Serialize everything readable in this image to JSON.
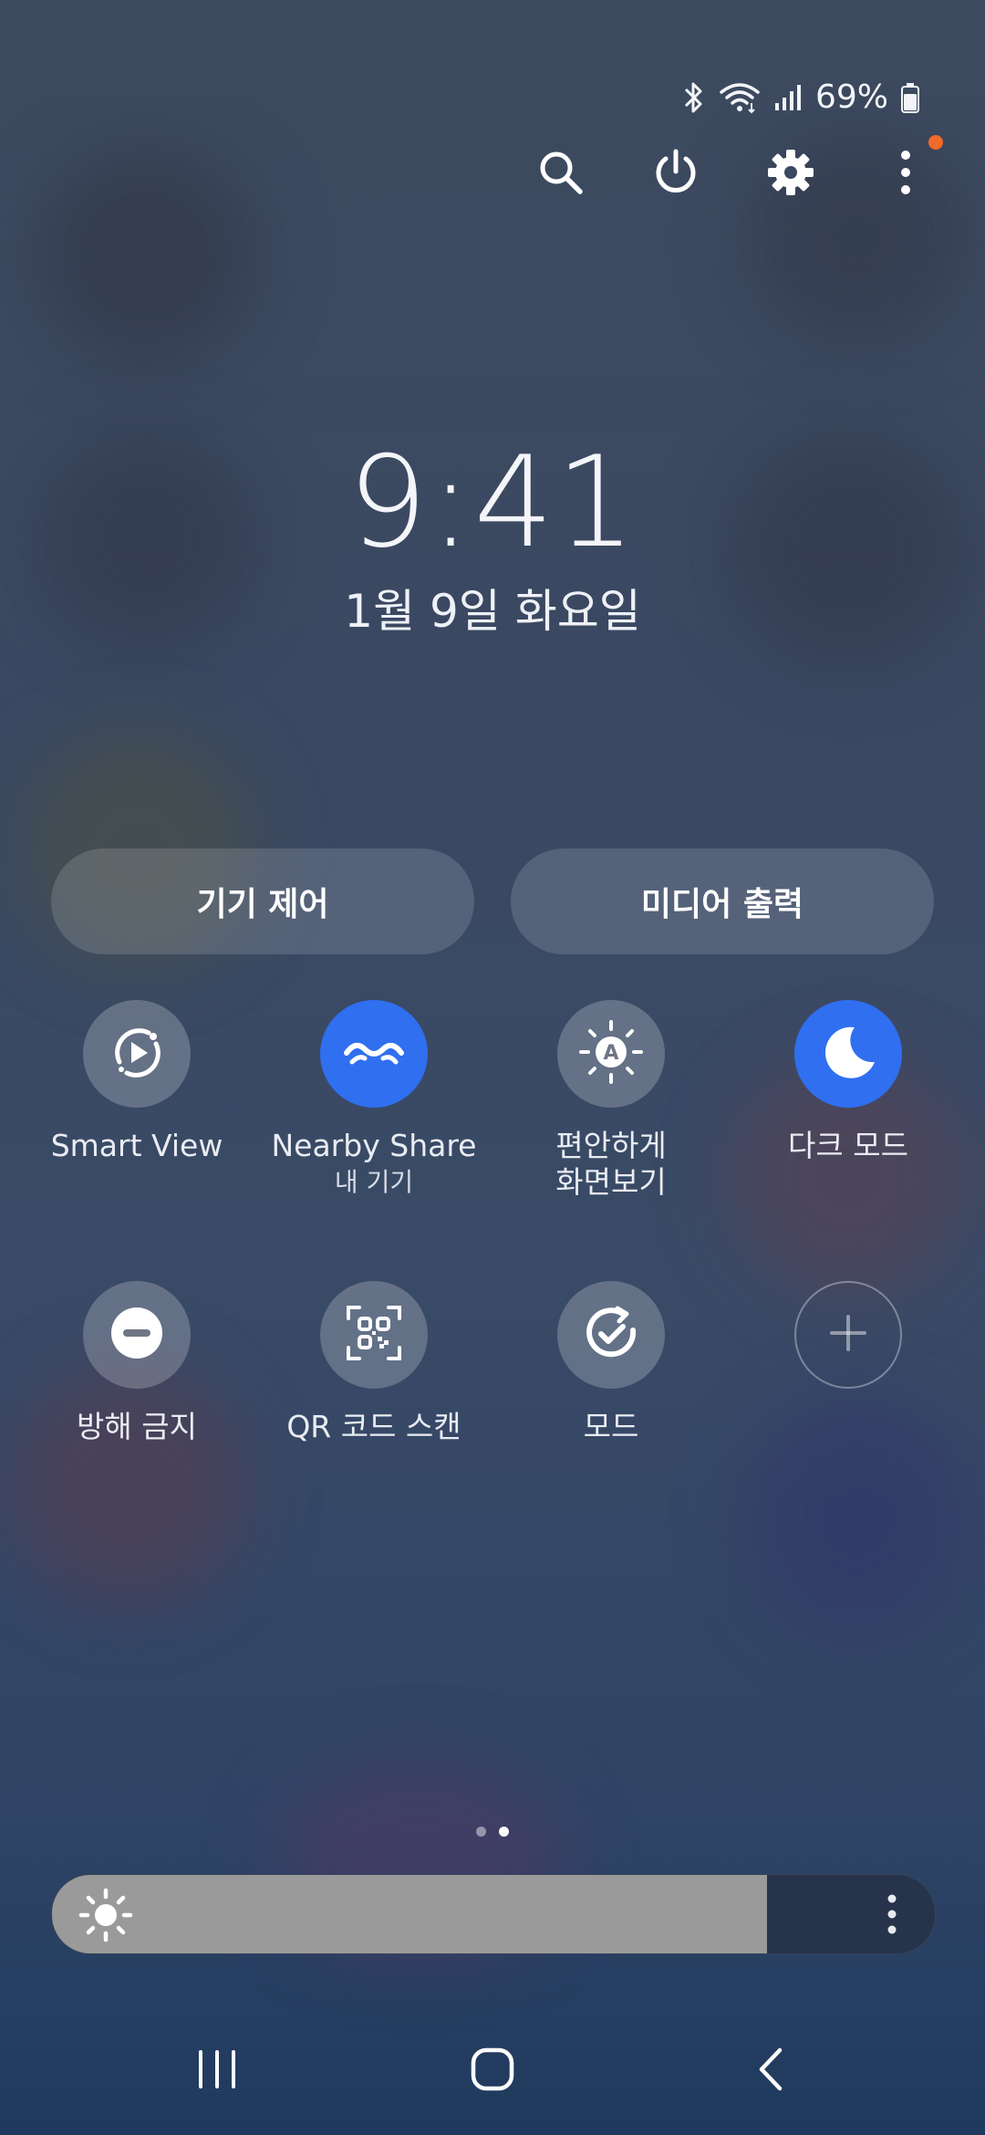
{
  "status": {
    "battery": "69%",
    "icons": [
      "bluetooth-icon",
      "wifi-icon",
      "signal-icon",
      "battery-icon"
    ]
  },
  "top_actions": {
    "icons": [
      "search-icon",
      "power-icon",
      "gear-icon",
      "more-vertical-icon"
    ],
    "notification_dot_color": "#f26a2a"
  },
  "clock": {
    "time": "9:41",
    "date": "1월 9일 화요일"
  },
  "pills": {
    "device_control": "기기 제어",
    "media_output": "미디어 출력"
  },
  "tiles": [
    {
      "label": "Smart View",
      "sub": "",
      "icon": "smart-view-icon",
      "state": "off"
    },
    {
      "label": "Nearby Share",
      "sub": "내 기기",
      "icon": "nearby-share-icon",
      "state": "on"
    },
    {
      "label": "편안하게",
      "label2": "화면보기",
      "icon": "eye-comfort-icon",
      "state": "off"
    },
    {
      "label": "다크 모드",
      "sub": "",
      "icon": "moon-icon",
      "state": "on"
    },
    {
      "label": "방해 금지",
      "sub": "",
      "icon": "do-not-disturb-icon",
      "state": "off"
    },
    {
      "label": "QR 코드 스캔",
      "sub": "",
      "icon": "qr-code-icon",
      "state": "off"
    },
    {
      "label": "모드",
      "sub": "",
      "icon": "modes-icon",
      "state": "off"
    },
    {
      "label": "",
      "sub": "",
      "icon": "plus-icon",
      "state": "add"
    }
  ],
  "pager": {
    "count": 2,
    "active": 2
  },
  "brightness": {
    "level": 0.81
  },
  "nav": {
    "icons": [
      "recent-apps-icon",
      "home-icon",
      "back-icon"
    ]
  },
  "colors": {
    "active_tile": "#2f6ff0",
    "brightness_fill": "#9a9a9a"
  }
}
